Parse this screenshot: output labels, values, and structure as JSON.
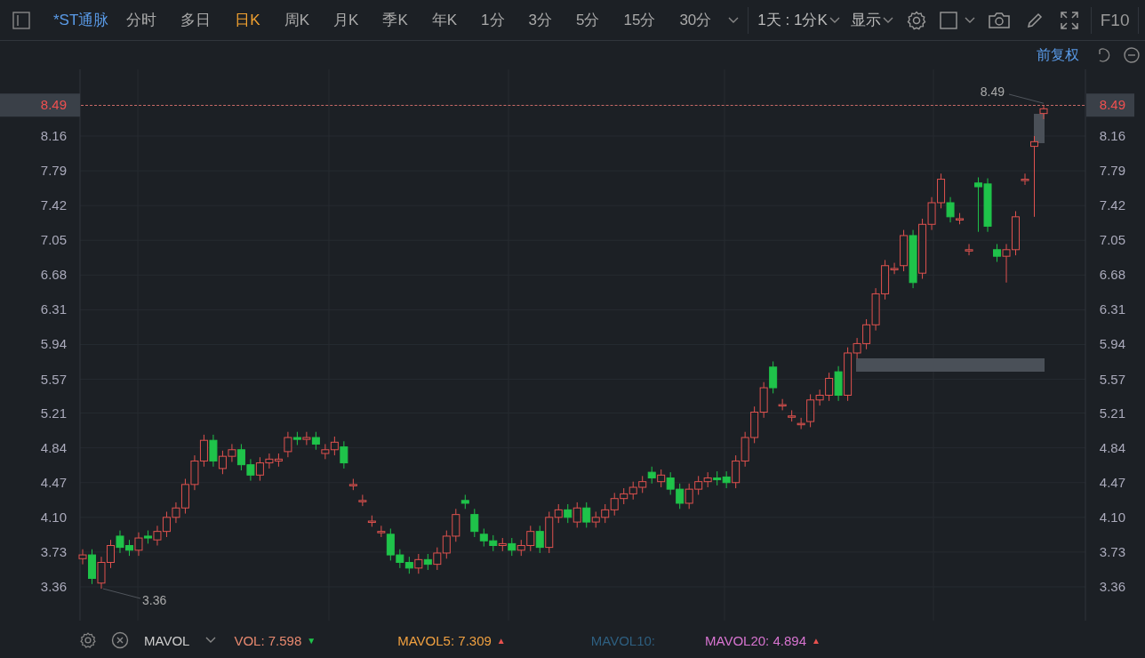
{
  "toolbar": {
    "symbol": "*ST通脉",
    "tabs": [
      {
        "label": "分时",
        "selected": false
      },
      {
        "label": "多日",
        "selected": false
      },
      {
        "label": "日K",
        "selected": true
      },
      {
        "label": "周K",
        "selected": false
      },
      {
        "label": "月K",
        "selected": false
      },
      {
        "label": "季K",
        "selected": false
      },
      {
        "label": "年K",
        "selected": false
      },
      {
        "label": "1分",
        "selected": false
      },
      {
        "label": "3分",
        "selected": false
      },
      {
        "label": "5分",
        "selected": false
      },
      {
        "label": "15分",
        "selected": false
      },
      {
        "label": "30分",
        "selected": false
      }
    ],
    "period_dropdown": "1天 : 1分K",
    "display_dropdown": "显示",
    "f10": "F10"
  },
  "adjust_link": "前复权",
  "chart": {
    "high_label": "8.49",
    "low_label": "3.36",
    "price_tags": [
      "8.49",
      "8.49"
    ],
    "right_axis_labels": [
      "8.16",
      "7.79",
      "7.42",
      "7.05",
      "6.68",
      "6.31",
      "5.94",
      "5.57",
      "5.21",
      "4.84",
      "4.47",
      "4.10",
      "3.73",
      "3.36"
    ],
    "chart_data": {
      "type": "candlestick",
      "grid": true,
      "ylim": [
        3.0,
        8.87
      ],
      "yticks": [
        {
          "value": 3.36,
          "label": "3.36"
        },
        {
          "value": 3.73,
          "label": "3.73"
        },
        {
          "value": 4.1,
          "label": "4.10"
        },
        {
          "value": 4.47,
          "label": "4.47"
        },
        {
          "value": 4.84,
          "label": "4.84"
        },
        {
          "value": 5.21,
          "label": "5.21"
        },
        {
          "value": 5.57,
          "label": "5.57"
        },
        {
          "value": 5.94,
          "label": "5.94"
        },
        {
          "value": 6.31,
          "label": "6.31"
        },
        {
          "value": 6.68,
          "label": "6.68"
        },
        {
          "value": 7.05,
          "label": "7.05"
        },
        {
          "value": 7.42,
          "label": "7.42"
        },
        {
          "value": 7.79,
          "label": "7.79"
        },
        {
          "value": 8.16,
          "label": "8.16"
        }
      ],
      "ohlc": [
        [
          3.66,
          3.76,
          3.6,
          3.7
        ],
        [
          3.7,
          3.76,
          3.39,
          3.45
        ],
        [
          3.4,
          3.68,
          3.34,
          3.62
        ],
        [
          3.62,
          3.86,
          3.56,
          3.8
        ],
        [
          3.9,
          3.96,
          3.72,
          3.78
        ],
        [
          3.8,
          3.86,
          3.69,
          3.75
        ],
        [
          3.75,
          3.94,
          3.69,
          3.88
        ],
        [
          3.9,
          3.96,
          3.82,
          3.88
        ],
        [
          3.86,
          4.01,
          3.8,
          3.95
        ],
        [
          3.95,
          4.16,
          3.89,
          4.1
        ],
        [
          4.1,
          4.26,
          4.04,
          4.2
        ],
        [
          4.2,
          4.51,
          4.14,
          4.45
        ],
        [
          4.45,
          4.76,
          4.39,
          4.7
        ],
        [
          4.7,
          4.98,
          4.64,
          4.92
        ],
        [
          4.92,
          4.98,
          4.64,
          4.7
        ],
        [
          4.62,
          4.81,
          4.56,
          4.75
        ],
        [
          4.75,
          4.88,
          4.69,
          4.82
        ],
        [
          4.82,
          4.88,
          4.6,
          4.66
        ],
        [
          4.66,
          4.72,
          4.49,
          4.55
        ],
        [
          4.55,
          4.74,
          4.49,
          4.68
        ],
        [
          4.68,
          4.78,
          4.62,
          4.72
        ],
        [
          4.7,
          4.78,
          4.64,
          4.72
        ],
        [
          4.8,
          5.01,
          4.74,
          4.95
        ],
        [
          4.95,
          5.01,
          4.87,
          4.93
        ],
        [
          4.93,
          5.01,
          4.87,
          4.95
        ],
        [
          4.95,
          5.01,
          4.82,
          4.88
        ],
        [
          4.78,
          4.88,
          4.72,
          4.82
        ],
        [
          4.82,
          4.96,
          4.76,
          4.9
        ],
        [
          4.85,
          4.91,
          4.62,
          4.68
        ],
        [
          4.45,
          4.51,
          4.39,
          4.45
        ],
        [
          4.28,
          4.34,
          4.22,
          4.28
        ],
        [
          4.06,
          4.12,
          4.0,
          4.06
        ],
        [
          3.95,
          4.01,
          3.89,
          3.95
        ],
        [
          3.92,
          3.98,
          3.64,
          3.7
        ],
        [
          3.7,
          3.76,
          3.56,
          3.62
        ],
        [
          3.62,
          3.68,
          3.5,
          3.56
        ],
        [
          3.56,
          3.71,
          3.5,
          3.65
        ],
        [
          3.65,
          3.71,
          3.54,
          3.6
        ],
        [
          3.6,
          3.78,
          3.54,
          3.72
        ],
        [
          3.72,
          3.96,
          3.66,
          3.9
        ],
        [
          3.9,
          4.19,
          3.84,
          4.13
        ],
        [
          4.28,
          4.34,
          4.19,
          4.25
        ],
        [
          4.13,
          4.19,
          3.89,
          3.95
        ],
        [
          3.92,
          3.98,
          3.79,
          3.85
        ],
        [
          3.85,
          3.91,
          3.74,
          3.8
        ],
        [
          3.8,
          3.88,
          3.74,
          3.82
        ],
        [
          3.82,
          3.88,
          3.69,
          3.75
        ],
        [
          3.75,
          3.86,
          3.69,
          3.8
        ],
        [
          3.8,
          4.01,
          3.74,
          3.95
        ],
        [
          3.95,
          4.01,
          3.72,
          3.78
        ],
        [
          3.78,
          4.16,
          3.72,
          4.1
        ],
        [
          4.1,
          4.24,
          4.04,
          4.18
        ],
        [
          4.18,
          4.24,
          4.04,
          4.1
        ],
        [
          4.05,
          4.26,
          3.99,
          4.2
        ],
        [
          4.2,
          4.26,
          3.99,
          4.05
        ],
        [
          4.05,
          4.16,
          3.99,
          4.1
        ],
        [
          4.1,
          4.24,
          4.04,
          4.18
        ],
        [
          4.18,
          4.36,
          4.12,
          4.3
        ],
        [
          4.3,
          4.41,
          4.24,
          4.35
        ],
        [
          4.35,
          4.48,
          4.29,
          4.42
        ],
        [
          4.42,
          4.54,
          4.36,
          4.48
        ],
        [
          4.58,
          4.64,
          4.46,
          4.52
        ],
        [
          4.48,
          4.61,
          4.42,
          4.55
        ],
        [
          4.52,
          4.58,
          4.34,
          4.4
        ],
        [
          4.4,
          4.46,
          4.19,
          4.25
        ],
        [
          4.25,
          4.46,
          4.19,
          4.4
        ],
        [
          4.4,
          4.54,
          4.34,
          4.48
        ],
        [
          4.48,
          4.58,
          4.42,
          4.52
        ],
        [
          4.52,
          4.59,
          4.44,
          4.5
        ],
        [
          4.53,
          4.59,
          4.41,
          4.47
        ],
        [
          4.47,
          4.76,
          4.41,
          4.7
        ],
        [
          4.7,
          5.01,
          4.64,
          4.95
        ],
        [
          4.95,
          5.28,
          4.89,
          5.22
        ],
        [
          5.22,
          5.54,
          5.16,
          5.48
        ],
        [
          5.7,
          5.76,
          5.42,
          5.48
        ],
        [
          5.3,
          5.36,
          5.24,
          5.3
        ],
        [
          5.18,
          5.24,
          5.12,
          5.18
        ],
        [
          5.1,
          5.16,
          5.04,
          5.1
        ],
        [
          5.12,
          5.41,
          5.06,
          5.35
        ],
        [
          5.35,
          5.46,
          5.29,
          5.4
        ],
        [
          5.4,
          5.64,
          5.34,
          5.58
        ],
        [
          5.65,
          5.71,
          5.34,
          5.4
        ],
        [
          5.4,
          5.91,
          5.34,
          5.85
        ],
        [
          5.85,
          6.01,
          5.79,
          5.95
        ],
        [
          5.95,
          6.21,
          5.89,
          6.15
        ],
        [
          6.15,
          6.54,
          6.09,
          6.48
        ],
        [
          6.48,
          6.84,
          6.42,
          6.78
        ],
        [
          6.75,
          6.81,
          6.69,
          6.75
        ],
        [
          6.78,
          7.16,
          6.72,
          7.1
        ],
        [
          7.1,
          7.16,
          6.54,
          6.6
        ],
        [
          6.7,
          7.28,
          6.64,
          7.22
        ],
        [
          7.22,
          7.51,
          7.16,
          7.45
        ],
        [
          7.45,
          7.76,
          7.39,
          7.7
        ],
        [
          7.45,
          7.51,
          7.24,
          7.3
        ],
        [
          7.28,
          7.34,
          7.22,
          7.28
        ],
        [
          6.95,
          7.01,
          6.89,
          6.95
        ],
        [
          7.66,
          7.72,
          7.14,
          7.62
        ],
        [
          7.65,
          7.71,
          7.14,
          7.2
        ],
        [
          6.95,
          7.01,
          6.82,
          6.88
        ],
        [
          6.88,
          7.01,
          6.6,
          6.95
        ],
        [
          6.95,
          7.36,
          6.89,
          7.3
        ],
        [
          7.7,
          7.76,
          7.64,
          7.7
        ],
        [
          8.05,
          8.16,
          7.3,
          8.1
        ],
        [
          8.4,
          8.49,
          8.34,
          8.45
        ]
      ]
    }
  },
  "indicator_bar": {
    "name": "MAVOL",
    "values": [
      {
        "label": "VOL:",
        "value": "7.598",
        "color": "#e8896f",
        "arrow": "▼",
        "kind": "down"
      },
      {
        "label": "MAVOL5:",
        "value": "7.309",
        "color": "#f0a040",
        "arrow": "▲",
        "kind": "up"
      },
      {
        "label": "MAVOL10:",
        "color": "#2e5f80"
      },
      {
        "label": "MAVOL20:",
        "value": "4.894",
        "color": "#d774d0",
        "arrow": "▲",
        "kind": "up"
      }
    ]
  }
}
